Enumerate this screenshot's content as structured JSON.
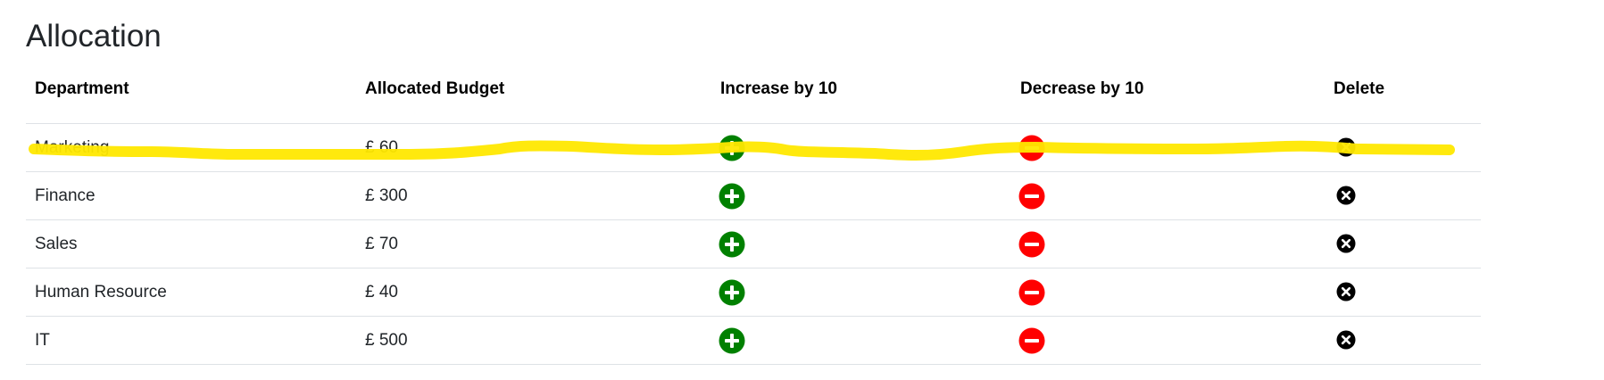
{
  "page": {
    "title": "Allocation"
  },
  "table": {
    "headers": {
      "department": "Department",
      "budget": "Allocated Budget",
      "increase": "Increase by 10",
      "decrease": "Decrease by 10",
      "delete": "Delete"
    },
    "rows": [
      {
        "department": "Marketing",
        "budget": "£ 60"
      },
      {
        "department": "Finance",
        "budget": "£ 300"
      },
      {
        "department": "Sales",
        "budget": "£ 70"
      },
      {
        "department": "Human Resource",
        "budget": "£ 40"
      },
      {
        "department": "IT",
        "budget": "£ 500"
      }
    ]
  },
  "icons": {
    "increase": "plus-circle-icon",
    "decrease": "minus-circle-icon",
    "delete": "close-circle-icon"
  },
  "colors": {
    "increase": "#008000",
    "decrease": "#ff0000",
    "delete": "#000000",
    "highlight": "#ffe800"
  }
}
